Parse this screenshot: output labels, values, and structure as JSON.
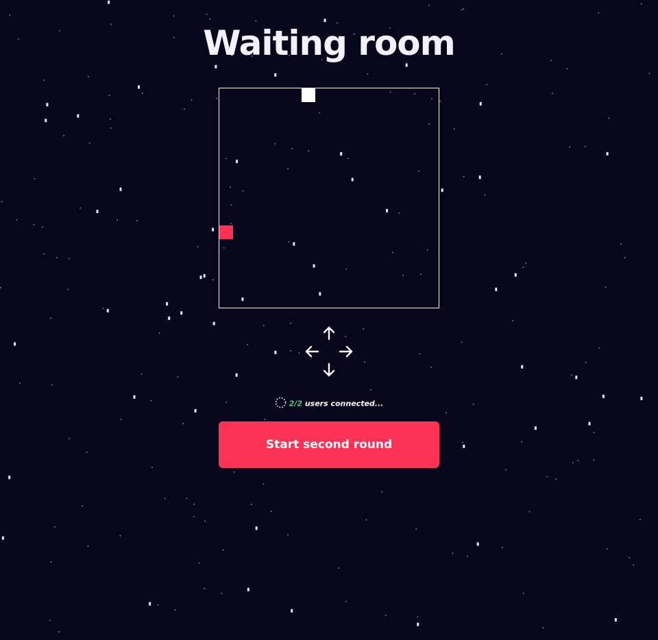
{
  "page": {
    "title": "Waiting room"
  },
  "colors": {
    "background": "#07061a",
    "accent": "#fb3255",
    "player_self": "#ffffff",
    "player_other": "#ff3152",
    "connected_count": "#37d67a"
  },
  "game": {
    "grid_size": 16,
    "players": [
      {
        "name": "player-self",
        "color": "#ffffff",
        "cell": [
          6,
          0
        ]
      },
      {
        "name": "player-other",
        "color": "#ff3152",
        "cell": [
          0,
          10
        ]
      }
    ]
  },
  "controls": {
    "icons": [
      "arrow-up-icon",
      "arrow-left-icon",
      "arrow-right-icon",
      "arrow-down-icon"
    ]
  },
  "status": {
    "connected": "2",
    "separator": "/",
    "total": "2",
    "suffix": "users connected..."
  },
  "actions": {
    "start_label": "Start second round"
  }
}
